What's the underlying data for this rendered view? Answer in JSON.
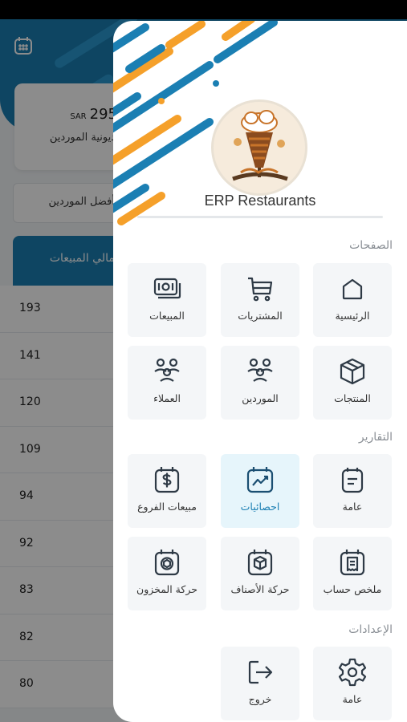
{
  "background": {
    "card": {
      "amount": "295",
      "currency": "SAR",
      "label": "مديونية الموردين"
    },
    "select_label": "أفضل الموردين",
    "table_header": "اجمالي المبيعات",
    "rows": [
      "193",
      "141",
      "120",
      "109",
      "94",
      "92",
      "83",
      "82",
      "80"
    ]
  },
  "drawer": {
    "app_name": "ERP Restaurants",
    "logo_icon": "shawarma-logo",
    "sections": {
      "pages": {
        "title": "الصفحات",
        "items": [
          {
            "label": "الرئيسية",
            "icon": "home-icon"
          },
          {
            "label": "المشتريات",
            "icon": "cart-icon"
          },
          {
            "label": "المبيعات",
            "icon": "cash-icon"
          },
          {
            "label": "المنتجات",
            "icon": "box-icon"
          },
          {
            "label": "الموردين",
            "icon": "users-icon"
          },
          {
            "label": "العملاء",
            "icon": "users-icon"
          }
        ]
      },
      "reports": {
        "title": "التقارير",
        "items": [
          {
            "label": "عامة",
            "icon": "report-icon"
          },
          {
            "label": "احصائيات",
            "icon": "chart-icon",
            "active": true
          },
          {
            "label": "مبيعات الفروع",
            "icon": "dollar-icon"
          },
          {
            "label": "ملخص حساب",
            "icon": "receipt-icon"
          },
          {
            "label": "حركة الأصناف",
            "icon": "box-calendar-icon"
          },
          {
            "label": "حركة المخزون",
            "icon": "stock-icon"
          }
        ]
      },
      "settings": {
        "title": "الإعدادات",
        "items": [
          {
            "label": "عامة",
            "icon": "gear-icon"
          },
          {
            "label": "خروج",
            "icon": "logout-icon"
          }
        ]
      }
    }
  },
  "colors": {
    "accent": "#1b7fb3",
    "orange": "#f5a02a",
    "tile_bg": "#f4f6f8"
  }
}
